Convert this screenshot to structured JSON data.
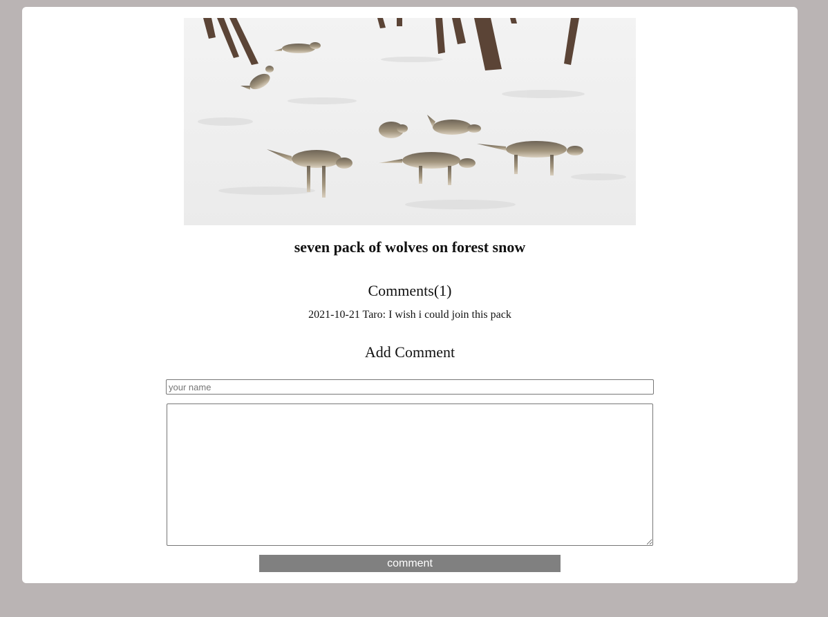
{
  "post": {
    "image_alt": "seven pack of wolves on forest snow",
    "title": "seven pack of wolves on forest snow"
  },
  "comments": {
    "heading": "Comments(1)",
    "items": [
      {
        "text": "2021-10-21 Taro: I wish i could join this pack"
      }
    ]
  },
  "add_comment": {
    "heading": "Add Comment",
    "name_placeholder": "your name",
    "name_value": "",
    "comment_value": "",
    "submit_label": "comment"
  },
  "colors": {
    "page_background": "#bab4b4",
    "card_background": "#ffffff",
    "button_background": "#808080",
    "button_text": "#ffffff"
  }
}
